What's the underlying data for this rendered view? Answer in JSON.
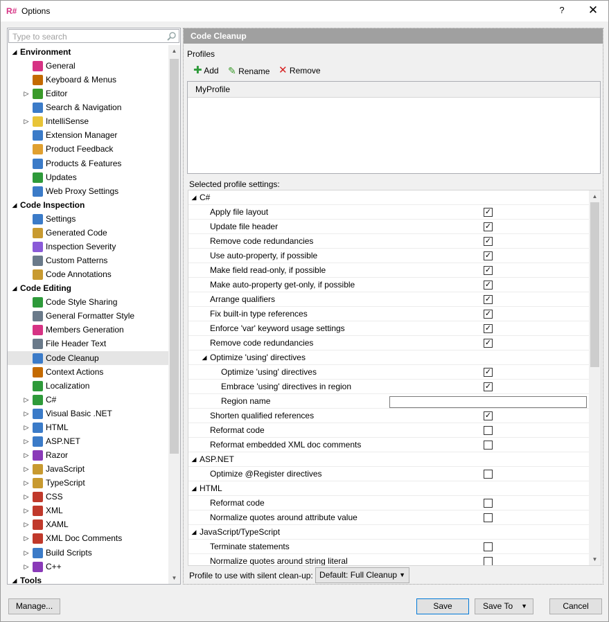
{
  "window": {
    "title": "Options",
    "help": "?",
    "close": "✕",
    "logo": "R#"
  },
  "search": {
    "placeholder": "Type to search"
  },
  "tree": [
    {
      "label": "Environment",
      "cat": true,
      "icon": "",
      "color": ""
    },
    {
      "label": "General",
      "icon": "resharper-icon",
      "color": "#d63384"
    },
    {
      "label": "Keyboard & Menus",
      "icon": "keyboard-icon",
      "color": "#c46a00"
    },
    {
      "label": "Editor",
      "icon": "pencil-icon",
      "color": "#3a9a2a",
      "exp": true
    },
    {
      "label": "Search & Navigation",
      "icon": "magnifier-icon",
      "color": "#3b7bc8"
    },
    {
      "label": "IntelliSense",
      "icon": "bulb-icon",
      "color": "#e8c437",
      "exp": true
    },
    {
      "label": "Extension Manager",
      "icon": "extension-icon",
      "color": "#3b7bc8"
    },
    {
      "label": "Product Feedback",
      "icon": "envelope-icon",
      "color": "#e0a030"
    },
    {
      "label": "Products & Features",
      "icon": "products-icon",
      "color": "#3b7bc8"
    },
    {
      "label": "Updates",
      "icon": "updates-icon",
      "color": "#2e9a3a"
    },
    {
      "label": "Web Proxy Settings",
      "icon": "globe-icon",
      "color": "#3b7bc8"
    },
    {
      "label": "Code Inspection",
      "cat": true,
      "icon": "",
      "color": ""
    },
    {
      "label": "Settings",
      "icon": "settings-icon",
      "color": "#3b7bc8"
    },
    {
      "label": "Generated Code",
      "icon": "generated-code-icon",
      "color": "#c89a30"
    },
    {
      "label": "Inspection Severity",
      "icon": "severity-icon",
      "color": "#8a5ad8"
    },
    {
      "label": "Custom Patterns",
      "icon": "patterns-icon",
      "color": "#6a7a8a"
    },
    {
      "label": "Code Annotations",
      "icon": "annotations-icon",
      "color": "#c89a30"
    },
    {
      "label": "Code Editing",
      "cat": true,
      "icon": "",
      "color": ""
    },
    {
      "label": "Code Style Sharing",
      "icon": "style-sharing-icon",
      "color": "#2e9a3a"
    },
    {
      "label": "General Formatter Style",
      "icon": "formatter-icon",
      "color": "#6a7a8a"
    },
    {
      "label": "Members Generation",
      "icon": "members-icon",
      "color": "#d63384"
    },
    {
      "label": "File Header Text",
      "icon": "header-icon",
      "color": "#6a7a8a"
    },
    {
      "label": "Code Cleanup",
      "icon": "broom-icon",
      "color": "#3b7bc8",
      "selected": true
    },
    {
      "label": "Context Actions",
      "icon": "hammer-icon",
      "color": "#c46a00"
    },
    {
      "label": "Localization",
      "icon": "localization-icon",
      "color": "#2e9a3a"
    },
    {
      "label": "C#",
      "icon": "csharp-icon",
      "color": "#2e9a3a",
      "exp": true
    },
    {
      "label": "Visual Basic .NET",
      "icon": "vb-icon",
      "color": "#3b7bc8",
      "exp": true
    },
    {
      "label": "HTML",
      "icon": "html-icon",
      "color": "#3b7bc8",
      "exp": true
    },
    {
      "label": "ASP.NET",
      "icon": "aspnet-icon",
      "color": "#3b7bc8",
      "exp": true
    },
    {
      "label": "Razor",
      "icon": "razor-icon",
      "color": "#8a3ab8",
      "exp": true
    },
    {
      "label": "JavaScript",
      "icon": "js-icon",
      "color": "#c89a30",
      "exp": true
    },
    {
      "label": "TypeScript",
      "icon": "ts-icon",
      "color": "#c89a30",
      "exp": true
    },
    {
      "label": "CSS",
      "icon": "css-icon",
      "color": "#c0392b",
      "exp": true
    },
    {
      "label": "XML",
      "icon": "xml-icon",
      "color": "#c0392b",
      "exp": true
    },
    {
      "label": "XAML",
      "icon": "xaml-icon",
      "color": "#c0392b",
      "exp": true
    },
    {
      "label": "XML Doc Comments",
      "icon": "xmldoc-icon",
      "color": "#c0392b",
      "exp": true
    },
    {
      "label": "Build Scripts",
      "icon": "build-icon",
      "color": "#3b7bc8",
      "exp": true
    },
    {
      "label": "C++",
      "icon": "cpp-icon",
      "color": "#8a3ab8",
      "exp": true
    },
    {
      "label": "Tools",
      "cat": true,
      "icon": "",
      "color": ""
    }
  ],
  "panel": {
    "title": "Code Cleanup",
    "profiles_label": "Profiles",
    "add": "Add",
    "rename": "Rename",
    "remove": "Remove",
    "profile_list_header": "MyProfile",
    "selected_settings_label": "Selected profile settings:",
    "silent_label": "Profile to use with silent clean-up:",
    "silent_value": "Default: Full Cleanup"
  },
  "settings": [
    {
      "label": "C#",
      "level": 0,
      "group": true
    },
    {
      "label": "Apply file layout",
      "level": 1,
      "checked": true
    },
    {
      "label": "Update file header",
      "level": 1,
      "checked": true
    },
    {
      "label": "Remove code redundancies",
      "level": 1,
      "checked": true
    },
    {
      "label": "Use auto-property, if possible",
      "level": 1,
      "checked": true
    },
    {
      "label": "Make field read-only, if possible",
      "level": 1,
      "checked": true
    },
    {
      "label": "Make auto-property get-only, if possible",
      "level": 1,
      "checked": true
    },
    {
      "label": "Arrange qualifiers",
      "level": 1,
      "checked": true
    },
    {
      "label": "Fix built-in type references",
      "level": 1,
      "checked": true
    },
    {
      "label": "Enforce 'var' keyword usage settings",
      "level": 1,
      "checked": true
    },
    {
      "label": "Remove code redundancies",
      "level": 1,
      "checked": true
    },
    {
      "label": "Optimize 'using' directives",
      "level": 1,
      "group": true
    },
    {
      "label": "Optimize 'using' directives",
      "level": 2,
      "checked": true
    },
    {
      "label": "Embrace 'using' directives in region",
      "level": 2,
      "checked": true
    },
    {
      "label": "Region name",
      "level": 2,
      "text": true
    },
    {
      "label": "Shorten qualified references",
      "level": 1,
      "checked": true
    },
    {
      "label": "Reformat code",
      "level": 1,
      "checked": false
    },
    {
      "label": "Reformat embedded XML doc comments",
      "level": 1,
      "checked": false
    },
    {
      "label": "ASP.NET",
      "level": 0,
      "group": true
    },
    {
      "label": "Optimize @Register directives",
      "level": 1,
      "checked": false
    },
    {
      "label": "HTML",
      "level": 0,
      "group": true
    },
    {
      "label": "Reformat code",
      "level": 1,
      "checked": false
    },
    {
      "label": "Normalize quotes around attribute value",
      "level": 1,
      "checked": false
    },
    {
      "label": "JavaScript/TypeScript",
      "level": 0,
      "group": true
    },
    {
      "label": "Terminate statements",
      "level": 1,
      "checked": false
    },
    {
      "label": "Normalize quotes around string literal",
      "level": 1,
      "checked": false
    }
  ],
  "buttons": {
    "manage": "Manage...",
    "save": "Save",
    "save_to": "Save To",
    "cancel": "Cancel"
  }
}
